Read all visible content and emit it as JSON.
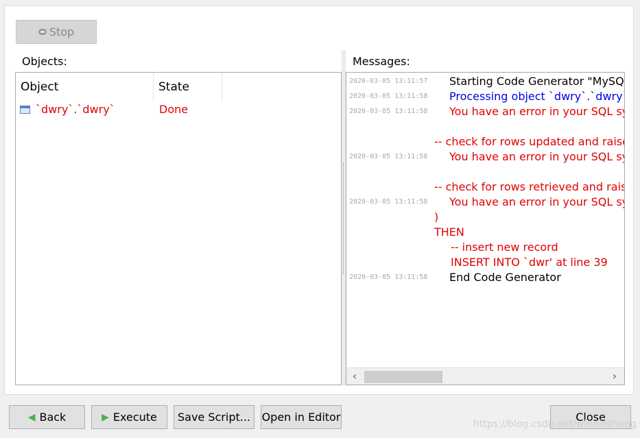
{
  "toolbar": {
    "stop_label": "Stop"
  },
  "objects": {
    "label": "Objects:",
    "columns": [
      "Object",
      "State"
    ],
    "rows": [
      {
        "object": "`dwry`.`dwry`",
        "state": "Done"
      }
    ]
  },
  "messages": {
    "label": "Messages:",
    "lines": [
      {
        "ts": "2020-03-05 13:11:57",
        "text": "Starting Code Generator \"MySQL C",
        "color": "#000000"
      },
      {
        "ts": "2020-03-05 13:11:58",
        "text": "Processing object `dwry`.`dwry`",
        "color": "#0000e0"
      },
      {
        "ts": "2020-03-05 13:11:58",
        "text": "You have an error in your SQL synt",
        "color": "#e00000"
      },
      {
        "ts": "",
        "text": "-- check for rows updated and raise a",
        "color": "#e00000"
      },
      {
        "ts": "2020-03-05 13:11:58",
        "text": "You have an error in your SQL synt",
        "color": "#e00000"
      },
      {
        "ts": "",
        "text": "-- check for rows retrieved and raise a",
        "color": "#e00000"
      },
      {
        "ts": "2020-03-05 13:11:58",
        "text": "You have an error in your SQL synt",
        "color": "#e00000"
      },
      {
        "ts": "",
        "text": ")",
        "color": "#e00000"
      },
      {
        "ts": "",
        "text": "THEN",
        "color": "#e00000"
      },
      {
        "ts": "",
        "text": "-- insert new record",
        "color": "#e00000"
      },
      {
        "ts": "",
        "text": "INSERT INTO `dwr' at line 39",
        "color": "#e00000"
      },
      {
        "ts": "2020-03-05 13:11:58",
        "text": "End Code Generator",
        "color": "#000000"
      }
    ]
  },
  "footer": {
    "back_label": "Back",
    "execute_label": "Execute",
    "save_script_label": "Save Script...",
    "open_editor_label": "Open in Editor",
    "close_label": "Close"
  },
  "watermark": "https://blog.csdn.net/winniezhang"
}
